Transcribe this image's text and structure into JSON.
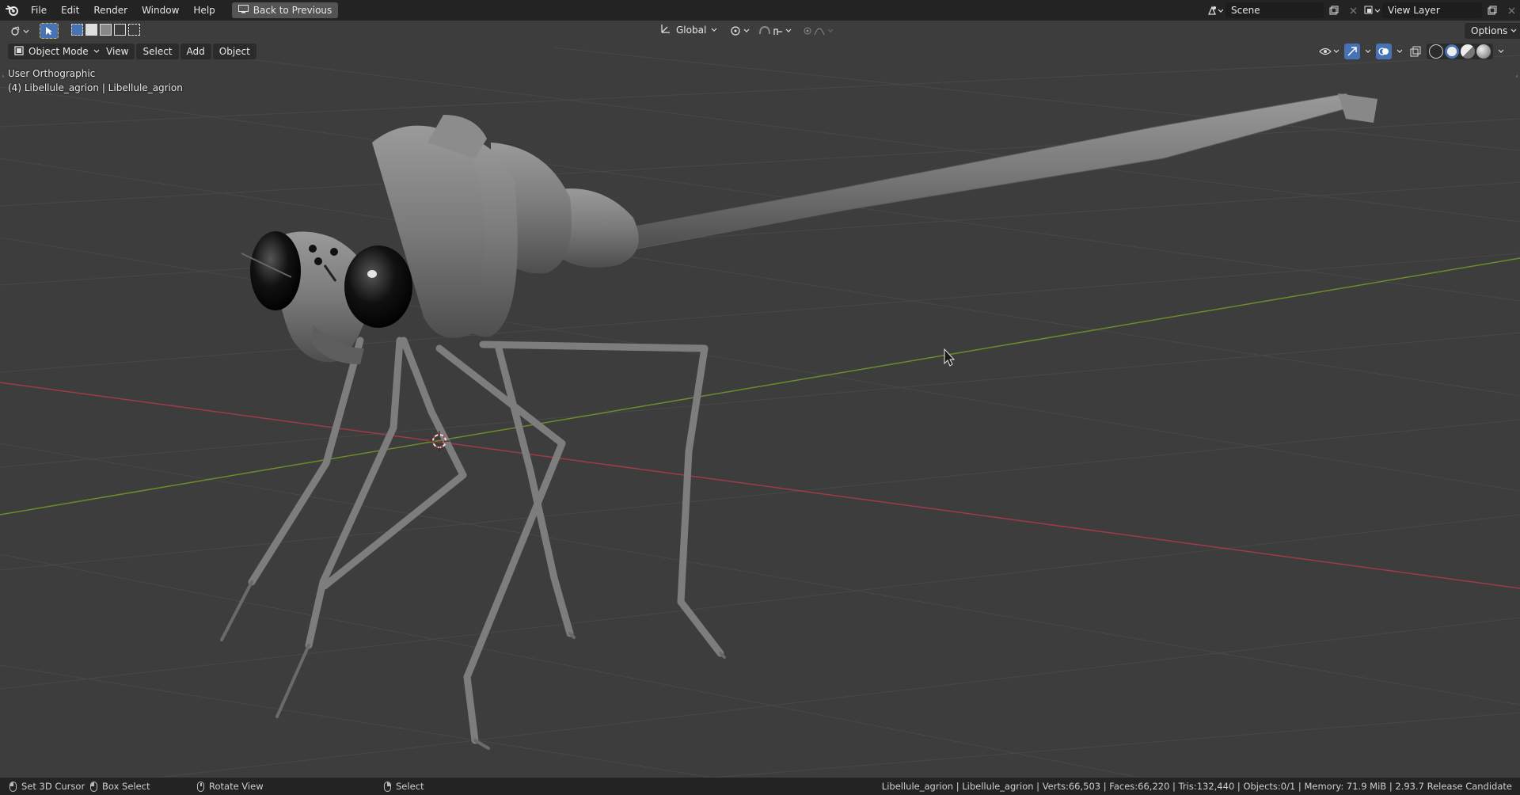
{
  "topbar": {
    "menu": [
      "File",
      "Edit",
      "Render",
      "Window",
      "Help"
    ],
    "back_button": "Back to Previous",
    "scene": {
      "value": "Scene"
    },
    "view_layer": {
      "value": "View Layer"
    }
  },
  "header": {
    "transform_orientation": "Global",
    "options_label": "Options",
    "mode": "Object Mode",
    "menus": [
      "View",
      "Select",
      "Add",
      "Object"
    ]
  },
  "viewport": {
    "view_name": "User Orthographic",
    "object_info": "(4) Libellule_agrion | Libellule_agrion"
  },
  "statusbar": {
    "items": [
      {
        "label": "Set 3D Cursor",
        "icon": "mouse-left-icon"
      },
      {
        "label": "Box Select",
        "icon": "mouse-drag-icon"
      },
      {
        "label": "Rotate View",
        "icon": "mouse-middle-icon"
      },
      {
        "label": "Select",
        "icon": "mouse-right-icon"
      }
    ],
    "stats": "Libellule_agrion | Libellule_agrion | Verts:66,503 | Faces:66,220 | Tris:132,440 | Objects:0/1 | Memory: 71.9 MiB | 2.93.7 Release Candidate"
  },
  "colors": {
    "topbar_bg": "#232323",
    "viewport_bg": "#3d3d3d",
    "x_axis": "#a13a49",
    "y_axis": "#6b8d2a",
    "accent": "#4772b3"
  }
}
